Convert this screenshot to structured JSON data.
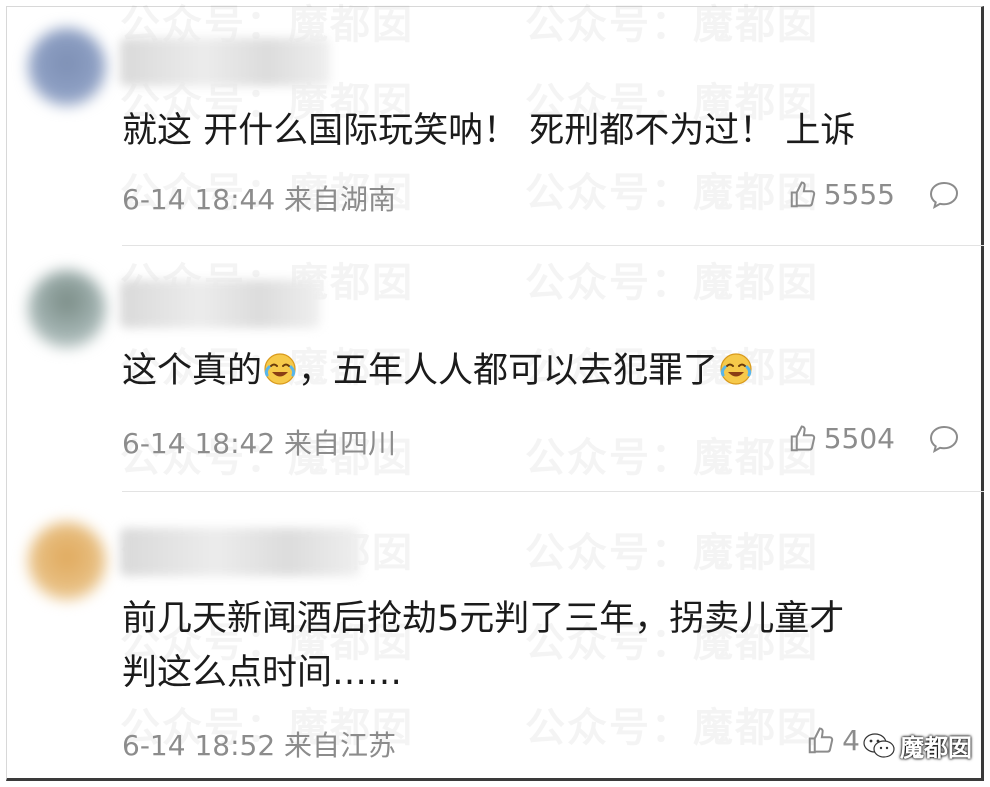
{
  "watermark": "公众号：魔都囡",
  "badge": {
    "label": "魔都囡"
  },
  "comments": [
    {
      "text_line1": "就这 开什么国际玩笑呐！ 死刑都不为过！ 上诉",
      "text_line2": "",
      "time": "6-14 18:44",
      "location": "来自湖南",
      "likes": "5555"
    },
    {
      "text_before": "这个真的",
      "text_middle": "，五年人人都可以去犯罪了",
      "time": "6-14 18:42",
      "location": "来自四川",
      "likes": "5504",
      "emoji": "laughing-crying-emoji"
    },
    {
      "text_line1": "前几天新闻酒后抢劫5元判了三年，拐卖儿童才",
      "text_line2": "判这么点时间……",
      "time": "6-14 18:52",
      "location": "来自江苏",
      "likes": "4"
    }
  ],
  "colors": {
    "meta": "#8c8c8c",
    "text": "#1b1b1b",
    "divider": "#e3e3e3"
  }
}
